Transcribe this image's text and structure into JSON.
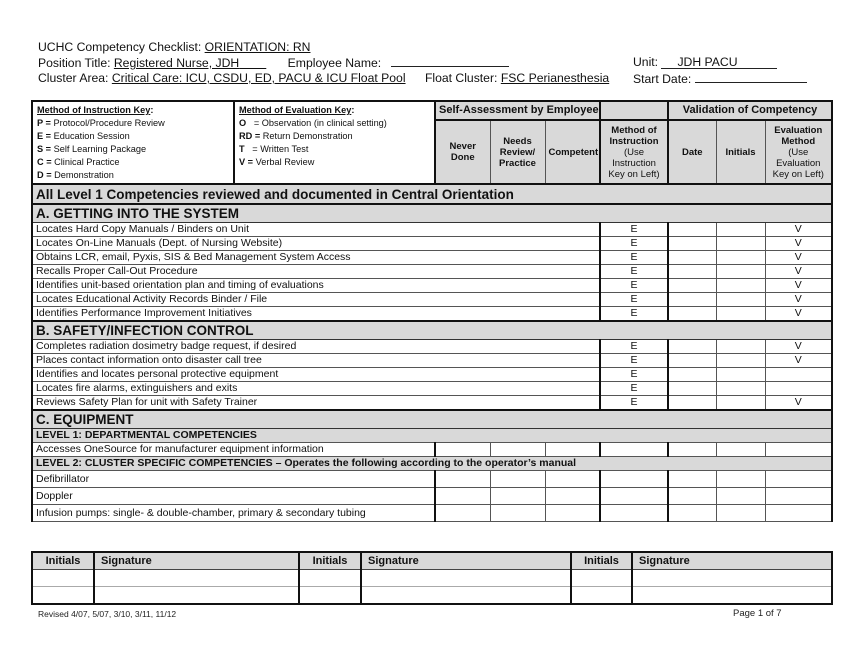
{
  "header": {
    "checklist_label": "UCHC Competency Checklist:",
    "checklist_value": "ORIENTATION: RN",
    "position_label": "Position Title:",
    "position_value": "Registered Nurse, JDH",
    "employee_label": "Employee Name:",
    "employee_value": "",
    "unit_label": "Unit:",
    "unit_value": "JDH PACU",
    "cluster_label": "Cluster Area:",
    "cluster_value": "Critical Care: ICU, CSDU, ED, PACU & ICU Float Pool",
    "float_label": "Float Cluster:",
    "float_value": "FSC Perianesthesia",
    "start_label": "Start Date:",
    "start_value": ""
  },
  "instruction_key": {
    "title": "Method of Instruction Key",
    "items": [
      {
        "code": "P =",
        "text": "Protocol/Procedure Review"
      },
      {
        "code": "E =",
        "text": "Education Session"
      },
      {
        "code": "S =",
        "text": "Self Learning Package"
      },
      {
        "code": "C =",
        "text": "Clinical Practice"
      },
      {
        "code": "D =",
        "text": "Demonstration"
      }
    ]
  },
  "evaluation_key": {
    "title": "Method of Evaluation Key",
    "items": [
      {
        "code": "O",
        "text": "= Observation (in clinical setting)"
      },
      {
        "code": "RD =",
        "text": "Return Demonstration"
      },
      {
        "code": "T",
        "text": "= Written Test"
      },
      {
        "code": "V =",
        "text": "Verbal Review"
      }
    ]
  },
  "columns": {
    "self_assessment_group": "Self-Assessment by Employee",
    "validation_group": "Validation of Competency",
    "never_done": "Never Done",
    "needs_review": "Needs Review/ Practice",
    "competent": "Competent",
    "method_bold": "Method of Instruction",
    "method_note": "(Use Instruction Key on Left)",
    "date": "Date",
    "initials": "Initials",
    "eval_bold": "Evaluation Method",
    "eval_note": "(Use Evaluation Key on Left)"
  },
  "banner": "All Level 1 Competencies reviewed and documented in Central Orientation",
  "sections": [
    {
      "title": "A.  GETTING INTO THE SYSTEM",
      "rows": [
        {
          "text": "Locates Hard Copy Manuals / Binders on Unit",
          "method": "E",
          "eval": "V"
        },
        {
          "text": "Locates On-Line Manuals (Dept. of Nursing Website)",
          "method": "E",
          "eval": "V"
        },
        {
          "text": "Obtains LCR, email, Pyxis, SIS & Bed Management System Access",
          "method": "E",
          "eval": "V"
        },
        {
          "text": "Recalls Proper Call-Out Procedure",
          "method": "E",
          "eval": "V"
        },
        {
          "text": "Identifies unit-based orientation plan and timing of evaluations",
          "method": "E",
          "eval": "V"
        },
        {
          "text": "Locates Educational Activity Records Binder / File",
          "method": "E",
          "eval": "V"
        },
        {
          "text": "Identifies Performance Improvement Initiatives",
          "method": "E",
          "eval": "V"
        }
      ]
    },
    {
      "title": "B. SAFETY/INFECTION CONTROL",
      "rows": [
        {
          "text": "Completes radiation dosimetry badge request, if desired",
          "method": "E",
          "eval": "V"
        },
        {
          "text": "Places contact information onto disaster call tree",
          "method": "E",
          "eval": "V"
        },
        {
          "text": "Identifies and locates personal protective equipment",
          "method": "E",
          "eval": ""
        },
        {
          "text": "Locates fire alarms, extinguishers and exits",
          "method": "E",
          "eval": ""
        },
        {
          "text": "Reviews Safety Plan for unit with Safety Trainer",
          "method": "E",
          "eval": "V"
        }
      ]
    },
    {
      "title": "C. EQUIPMENT",
      "level1": "LEVEL 1: DEPARTMENTAL COMPETENCIES",
      "level1_rows": [
        {
          "text": "Accesses OneSource for manufacturer equipment information",
          "method": "",
          "eval": ""
        }
      ],
      "level2": "LEVEL 2: CLUSTER SPECIFIC COMPETENCIES – Operates the following according to the operator’s manual",
      "level2_rows": [
        {
          "text": "Defibrillator",
          "method": "",
          "eval": ""
        },
        {
          "text": "Doppler",
          "method": "",
          "eval": ""
        },
        {
          "text": "Infusion pumps: single- & double-chamber, primary & secondary tubing",
          "method": "",
          "eval": ""
        }
      ]
    }
  ],
  "signature_table": {
    "initials_label": "Initials",
    "signature_label": "Signature"
  },
  "footer": {
    "revised": "Revised 4/07, 5/07, 3/10, 3/11, 11/12",
    "page": "Page 1 of 7"
  }
}
